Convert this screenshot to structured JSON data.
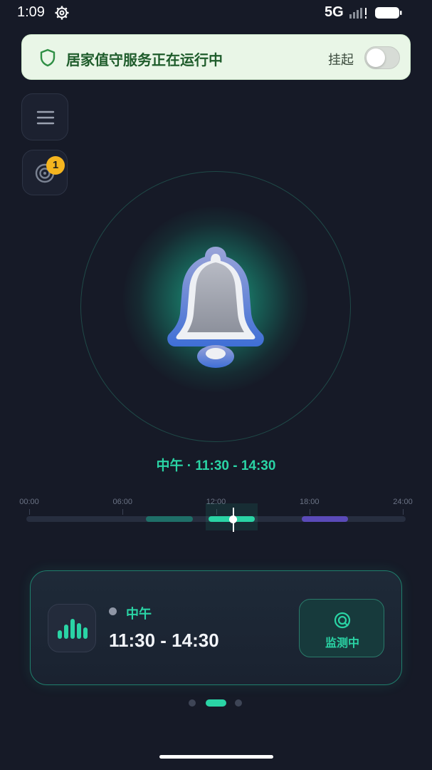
{
  "status_bar": {
    "time": "1:09",
    "network": "5G",
    "icons": [
      "gear-icon",
      "signal-icon",
      "battery-icon"
    ]
  },
  "service_banner": {
    "icon": "shield-icon",
    "text": "居家值守服务正在运行中",
    "suspend_label": "挂起",
    "toggle_on": false
  },
  "side_buttons": {
    "menu_icon": "menu-icon",
    "radar_icon": "radar-icon",
    "radar_badge": "1"
  },
  "bell": {
    "icon": "bell-icon"
  },
  "current_period": "中午 · 11:30 - 14:30",
  "timeline": {
    "ticks": [
      "00:00",
      "06:00",
      "12:00",
      "18:00",
      "24:00"
    ],
    "segments": [
      {
        "name": "morning",
        "start_hour": 7.5,
        "end_hour": 10.5,
        "color": "#1f6f68"
      },
      {
        "name": "noon",
        "start_hour": 11.5,
        "end_hour": 14.5,
        "color": "#2ad4a5"
      },
      {
        "name": "evening",
        "start_hour": 17.5,
        "end_hour": 20.5,
        "color": "#5a4ab8"
      }
    ],
    "cursor_hour": 13.1
  },
  "card": {
    "icon": "sound-wave-icon",
    "period": "中午",
    "time_range": "11:30 - 14:30",
    "monitor_icon": "radar-icon",
    "monitor_label": "监测中"
  },
  "pager": {
    "count": 3,
    "active_index": 1
  },
  "colors": {
    "accent": "#2ad4a5",
    "background": "#161a27",
    "banner_bg": "#e9f6e7",
    "badge": "#f5b51f"
  }
}
